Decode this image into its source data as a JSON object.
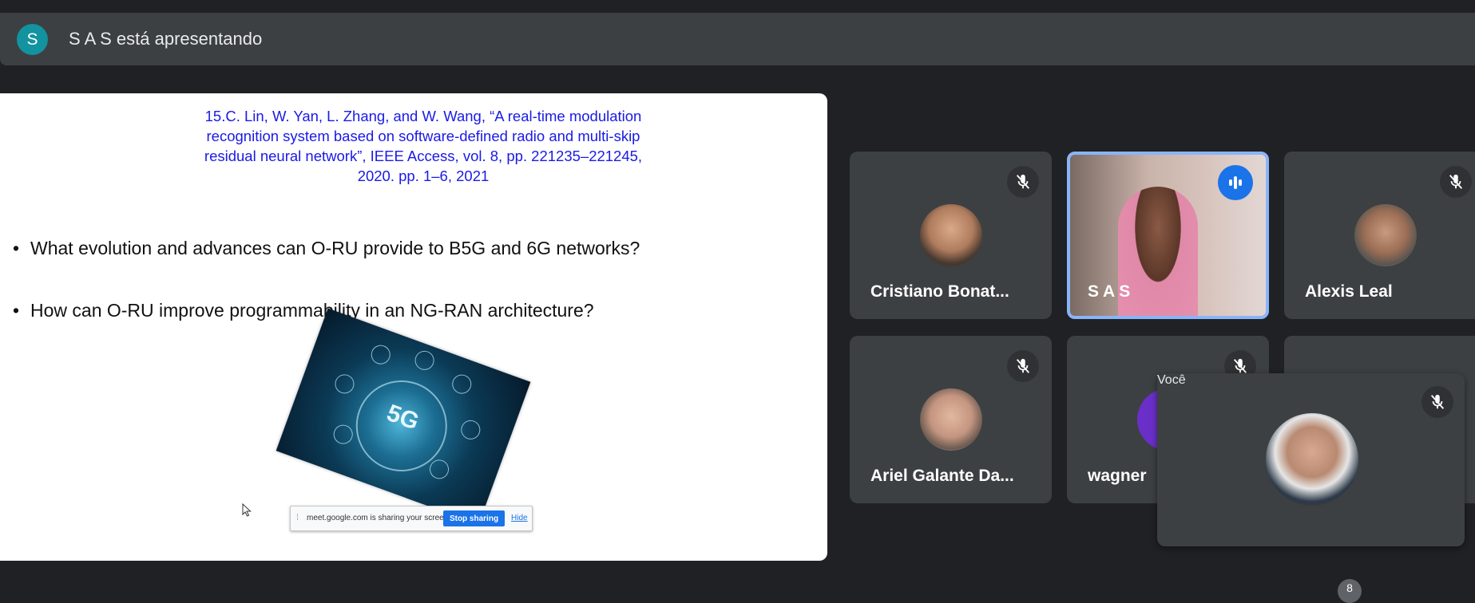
{
  "header": {
    "avatar_letter": "S",
    "presenting_text": "S A S está apresentando"
  },
  "slide": {
    "reference_lines": [
      "15.C. Lin, W. Yan, L. Zhang, and W. Wang, “A real-time modulation",
      "recognition system based on software-defined radio and multi-skip",
      "residual neural network”, IEEE Access, vol. 8, pp. 221235–221245,",
      "2020. pp. 1–6, 2021"
    ],
    "bullets": [
      "What evolution and advances can O-RU provide to B5G and 6G networks?",
      "How can O-RU improve programmability in an NG-RAN architecture?"
    ],
    "image_label": "5G",
    "share_bar": {
      "message": "meet.google.com is sharing your screen.",
      "stop_label": "Stop sharing",
      "hide_label": "Hide"
    }
  },
  "participants": [
    {
      "name": "Cristiano Bonat...",
      "muted": true
    },
    {
      "name": "S A S",
      "muted": false,
      "speaking": true
    },
    {
      "name": "Alexis Leal",
      "muted": true
    },
    {
      "name": "Ariel Galante Da...",
      "muted": true
    },
    {
      "name": "wagner",
      "muted": true
    }
  ],
  "self_view": {
    "name": "Você",
    "muted": true
  },
  "overflow_badge": "8",
  "colors": {
    "accent": "#1a73e8",
    "avatar": "#12939f",
    "tile": "#3c4043",
    "background": "#202124"
  }
}
